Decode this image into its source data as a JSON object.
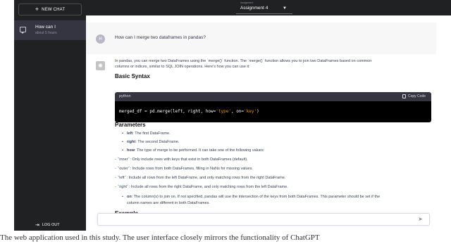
{
  "sidebar": {
    "new_chat": "NEW CHAT",
    "chat": {
      "title": "How can I",
      "time": "about 5 hours"
    },
    "logout": "LOG OUT"
  },
  "topbar": {
    "caption": "Assignment",
    "value": "Assignment 4"
  },
  "user": {
    "initial": "H",
    "message": "How can I merge two dataframes in pandas?"
  },
  "assistant": {
    "intro_1": "In pandas, you can merge two DataFrames using the `merge()` function. The `merge()` function allows you to join two DataFrames based on common",
    "intro_2": "columns or indices, similar to SQL JOIN operations. Here's how you can use it:",
    "basic_syntax": "Basic Syntax",
    "code_lang": "python",
    "copy_label": "Copy Code",
    "code_pre": "merged_df = pd.merge(left, right, how=",
    "code_str1": "'type'",
    "code_mid": ", on=",
    "code_str2": "'key'",
    "code_post": ")",
    "parameters": "Parameters",
    "p_left_k": "left",
    "p_left_v": ": The first DataFrame.",
    "p_right_k": "right",
    "p_right_v": ": The second DataFrame.",
    "p_how_k": "how",
    "p_how_v": ": The type of merge to be performed. It can take one of the following values:",
    "opt_inner": "- `'inner'`: Only include rows with keys that exist in both DataFrames (default).",
    "opt_outer": "- `'outer'`: Include rows from both DataFrames, filling in NaNs for missing values.",
    "opt_left": "- `'left'`: Include all rows from the left DataFrame, and only matching rows from the right DataFrame.",
    "opt_right": "- `'right'`: Include all rows from the right DataFrame, and only matching rows from the left DataFrame.",
    "p_on_k": "on",
    "p_on_v": ": The column(s) to join on. If not specified, pandas will use the intersection of the keys from both DataFrames. This parameter should be set if the",
    "p_on_v2": "column names are different in both DataFrames.",
    "example": "Example"
  },
  "caption": "The web application used in this study. The user interface closely mirrors the functionality of ChatGPT"
}
